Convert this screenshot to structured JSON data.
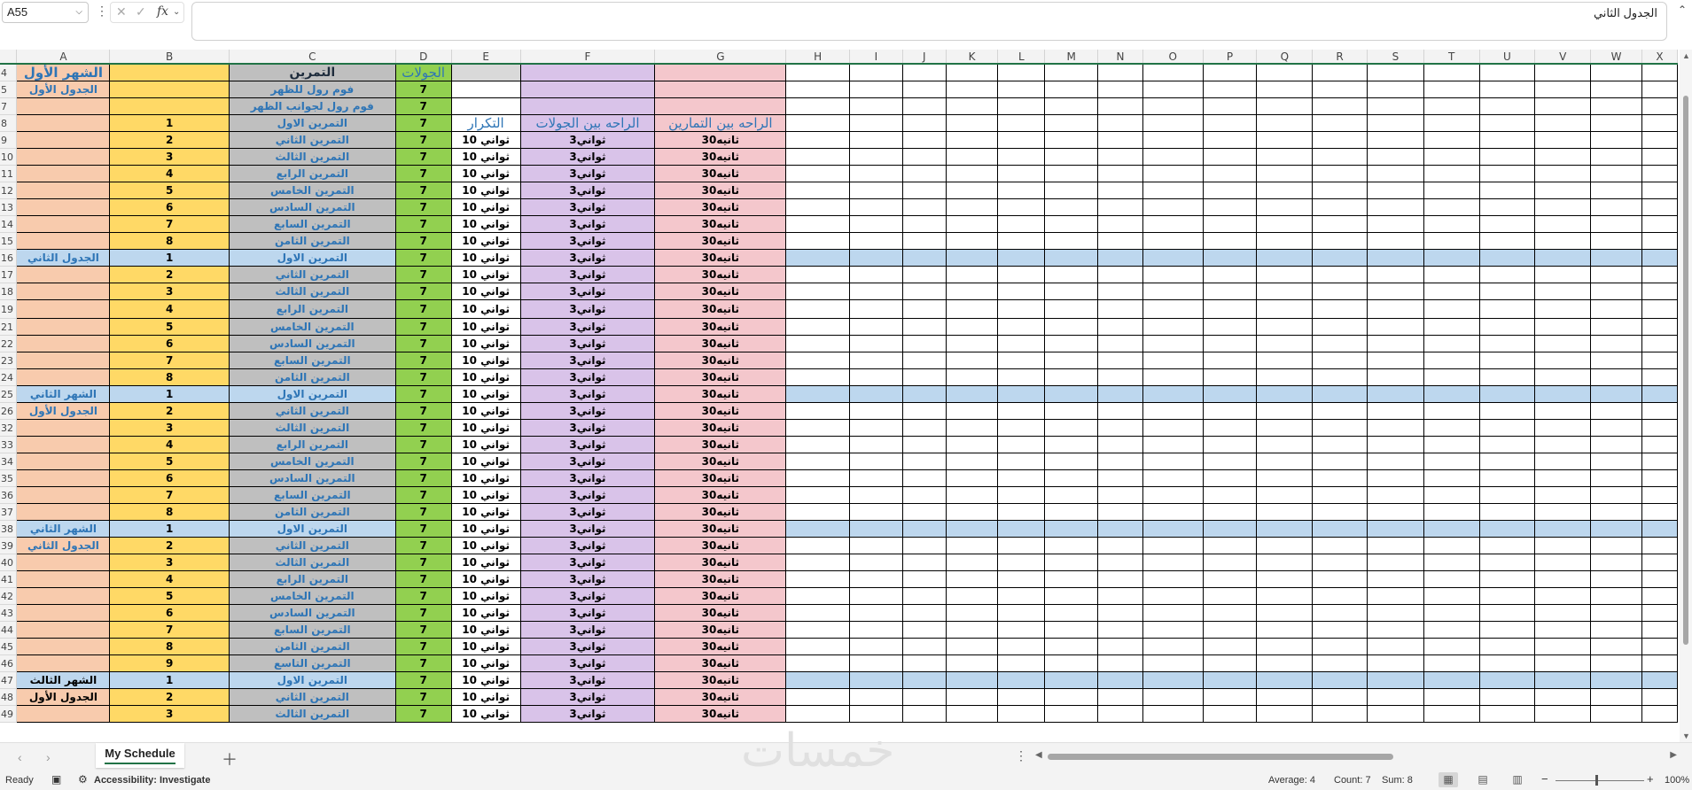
{
  "formula_bar": {
    "name_box": "A55",
    "fx": "fx",
    "content": "الجدول الثاني"
  },
  "columns": [
    "A",
    "B",
    "C",
    "D",
    "E",
    "F",
    "G",
    "H",
    "I",
    "J",
    "K",
    "L",
    "M",
    "N",
    "O",
    "P",
    "Q",
    "R",
    "S",
    "T",
    "U",
    "V",
    "W",
    "X"
  ],
  "header_row": {
    "row": "4",
    "a": "الشهر الأول",
    "b": "",
    "c": "التمرين",
    "d": "الجولات",
    "e": "",
    "f": "",
    "g": ""
  },
  "intro_rows": [
    {
      "row": "5",
      "a": "الجدول الأول",
      "b": "",
      "c": "فوم رول للظهر",
      "d": "7",
      "e": "",
      "f": "",
      "g": ""
    },
    {
      "row": "7",
      "a": "",
      "b": "",
      "c": "فوم رول لجوانب الظهر",
      "d": "7",
      "e": "",
      "f": "",
      "g": ""
    },
    {
      "row": "8",
      "a": "",
      "b": "1",
      "c": "التمرين الاول",
      "d": "7",
      "e": "التكرار",
      "f": "الراحه بين الجولات",
      "g": "الراحه بين التمارين"
    }
  ],
  "rows": [
    {
      "row": "9",
      "a": "",
      "b": "2",
      "c": "التمرين الثاني",
      "d": "7",
      "e": "10 ثواني",
      "f": "3ثواني",
      "g": "30ثانيه"
    },
    {
      "row": "10",
      "a": "",
      "b": "3",
      "c": "التمرين الثالث",
      "d": "7",
      "e": "10 ثواني",
      "f": "3ثواني",
      "g": "30ثانيه"
    },
    {
      "row": "11",
      "a": "",
      "b": "4",
      "c": "التمرين الرابع",
      "d": "7",
      "e": "10 ثواني",
      "f": "3ثواني",
      "g": "30ثانيه"
    },
    {
      "row": "12",
      "a": "",
      "b": "5",
      "c": "التمرين الخامس",
      "d": "7",
      "e": "10 ثواني",
      "f": "3ثواني",
      "g": "30ثانيه"
    },
    {
      "row": "13",
      "a": "",
      "b": "6",
      "c": "التمرين السادس",
      "d": "7",
      "e": "10 ثواني",
      "f": "3ثواني",
      "g": "30ثانيه"
    },
    {
      "row": "14",
      "a": "",
      "b": "7",
      "c": "التمرين السابع",
      "d": "7",
      "e": "10 ثواني",
      "f": "3ثواني",
      "g": "30ثانيه"
    },
    {
      "row": "15",
      "a": "",
      "b": "8",
      "c": "التمرين الثامن",
      "d": "7",
      "e": "10 ثواني",
      "f": "3ثواني",
      "g": "30ثانيه"
    },
    {
      "row": "16",
      "a": "الجدول الثاني",
      "b": "1",
      "c": "التمرين الاول",
      "d": "7",
      "e": "10 ثواني",
      "f": "3ثواني",
      "g": "30ثانيه",
      "hl": true
    },
    {
      "row": "17",
      "a": "",
      "b": "2",
      "c": "التمرين الثاني",
      "d": "7",
      "e": "10 ثواني",
      "f": "3ثواني",
      "g": "30ثانيه"
    },
    {
      "row": "18",
      "a": "",
      "b": "3",
      "c": "التمرين الثالث",
      "d": "7",
      "e": "10 ثواني",
      "f": "3ثواني",
      "g": "30ثانيه"
    },
    {
      "row": "19",
      "a": "",
      "b": "4",
      "c": "التمرين الرابع",
      "d": "7",
      "e": "10 ثواني",
      "f": "3ثواني",
      "g": "30ثانيه",
      "tall": true
    },
    {
      "row": "21",
      "a": "",
      "b": "5",
      "c": "التمرين الخامس",
      "d": "7",
      "e": "10 ثواني",
      "f": "3ثواني",
      "g": "30ثانيه"
    },
    {
      "row": "22",
      "a": "",
      "b": "6",
      "c": "التمرين السادس",
      "d": "7",
      "e": "10 ثواني",
      "f": "3ثواني",
      "g": "30ثانيه"
    },
    {
      "row": "23",
      "a": "",
      "b": "7",
      "c": "التمرين السابع",
      "d": "7",
      "e": "10 ثواني",
      "f": "3ثواني",
      "g": "30ثانيه"
    },
    {
      "row": "24",
      "a": "",
      "b": "8",
      "c": "التمرين الثامن",
      "d": "7",
      "e": "10 ثواني",
      "f": "3ثواني",
      "g": "30ثانيه"
    },
    {
      "row": "25",
      "a": "الشهر الثاني",
      "b": "1",
      "c": "التمرين الاول",
      "d": "7",
      "e": "10 ثواني",
      "f": "3ثواني",
      "g": "30ثانيه",
      "hl": true
    },
    {
      "row": "26",
      "a": "الجدول الأول",
      "b": "2",
      "c": "التمرين الثاني",
      "d": "7",
      "e": "10 ثواني",
      "f": "3ثواني",
      "g": "30ثانيه"
    },
    {
      "row": "32",
      "a": "",
      "b": "3",
      "c": "التمرين الثالث",
      "d": "7",
      "e": "10 ثواني",
      "f": "3ثواني",
      "g": "30ثانيه"
    },
    {
      "row": "33",
      "a": "",
      "b": "4",
      "c": "التمرين الرابع",
      "d": "7",
      "e": "10 ثواني",
      "f": "3ثواني",
      "g": "30ثانيه"
    },
    {
      "row": "34",
      "a": "",
      "b": "5",
      "c": "التمرين الخامس",
      "d": "7",
      "e": "10 ثواني",
      "f": "3ثواني",
      "g": "30ثانيه"
    },
    {
      "row": "35",
      "a": "",
      "b": "6",
      "c": "التمرين السادس",
      "d": "7",
      "e": "10 ثواني",
      "f": "3ثواني",
      "g": "30ثانيه"
    },
    {
      "row": "36",
      "a": "",
      "b": "7",
      "c": "التمرين السابع",
      "d": "7",
      "e": "10 ثواني",
      "f": "3ثواني",
      "g": "30ثانيه"
    },
    {
      "row": "37",
      "a": "",
      "b": "8",
      "c": "التمرين الثامن",
      "d": "7",
      "e": "10 ثواني",
      "f": "3ثواني",
      "g": "30ثانيه"
    },
    {
      "row": "38",
      "a": "الشهر الثاني",
      "b": "1",
      "c": "التمرين الاول",
      "d": "7",
      "e": "10 ثواني",
      "f": "3ثواني",
      "g": "30ثانيه",
      "hl": true
    },
    {
      "row": "39",
      "a": "الجدول الثاني",
      "b": "2",
      "c": "التمرين الثاني",
      "d": "7",
      "e": "10 ثواني",
      "f": "3ثواني",
      "g": "30ثانيه"
    },
    {
      "row": "40",
      "a": "",
      "b": "3",
      "c": "التمرين الثالث",
      "d": "7",
      "e": "10 ثواني",
      "f": "3ثواني",
      "g": "30ثانيه"
    },
    {
      "row": "41",
      "a": "",
      "b": "4",
      "c": "التمرين الرابع",
      "d": "7",
      "e": "10 ثواني",
      "f": "3ثواني",
      "g": "30ثانيه"
    },
    {
      "row": "42",
      "a": "",
      "b": "5",
      "c": "التمرين الخامس",
      "d": "7",
      "e": "10 ثواني",
      "f": "3ثواني",
      "g": "30ثانيه"
    },
    {
      "row": "43",
      "a": "",
      "b": "6",
      "c": "التمرين السادس",
      "d": "7",
      "e": "10 ثواني",
      "f": "3ثواني",
      "g": "30ثانيه"
    },
    {
      "row": "44",
      "a": "",
      "b": "7",
      "c": "التمرين السابع",
      "d": "7",
      "e": "10 ثواني",
      "f": "3ثواني",
      "g": "30ثانيه"
    },
    {
      "row": "45",
      "a": "",
      "b": "8",
      "c": "التمرين الثامن",
      "d": "7",
      "e": "10 ثواني",
      "f": "3ثواني",
      "g": "30ثانيه"
    },
    {
      "row": "46",
      "a": "",
      "b": "9",
      "c": "التمرين التاسع",
      "d": "7",
      "e": "10 ثواني",
      "f": "3ثواني",
      "g": "30ثانيه"
    },
    {
      "row": "47",
      "a": "الشهر الثالث",
      "b": "1",
      "c": "التمرين الاول",
      "d": "7",
      "e": "10 ثواني",
      "f": "3ثواني",
      "g": "30ثانيه",
      "hl": true,
      "boldA": true
    },
    {
      "row": "48",
      "a": "الجدول الأول",
      "b": "2",
      "c": "التمرين الثاني",
      "d": "7",
      "e": "10 ثواني",
      "f": "3ثواني",
      "g": "30ثانيه",
      "boldA": true
    },
    {
      "row": "49",
      "a": "",
      "b": "3",
      "c": "التمرين الثالث",
      "d": "7",
      "e": "10 ثواني",
      "f": "3ثواني",
      "g": "30ثانيه"
    }
  ],
  "sheet_tabs": [
    "My Schedule"
  ],
  "status": {
    "ready": "Ready",
    "accessibility": "Accessibility: Investigate",
    "average": "Average: 4",
    "count": "Count: 7",
    "sum": "Sum: 8",
    "zoom": "100%"
  },
  "watermark": "خمسات",
  "colors": {
    "A": "#f8cbad",
    "B": "#ffd966",
    "C": "#bfbfbf",
    "D": "#92d050",
    "E": "#d9d9d9",
    "F": "#d9c3e9",
    "G": "#f4c7cc",
    "highlight": "#bdd7ee",
    "link_text": "#2e75b6",
    "excel_green": "#217346"
  }
}
